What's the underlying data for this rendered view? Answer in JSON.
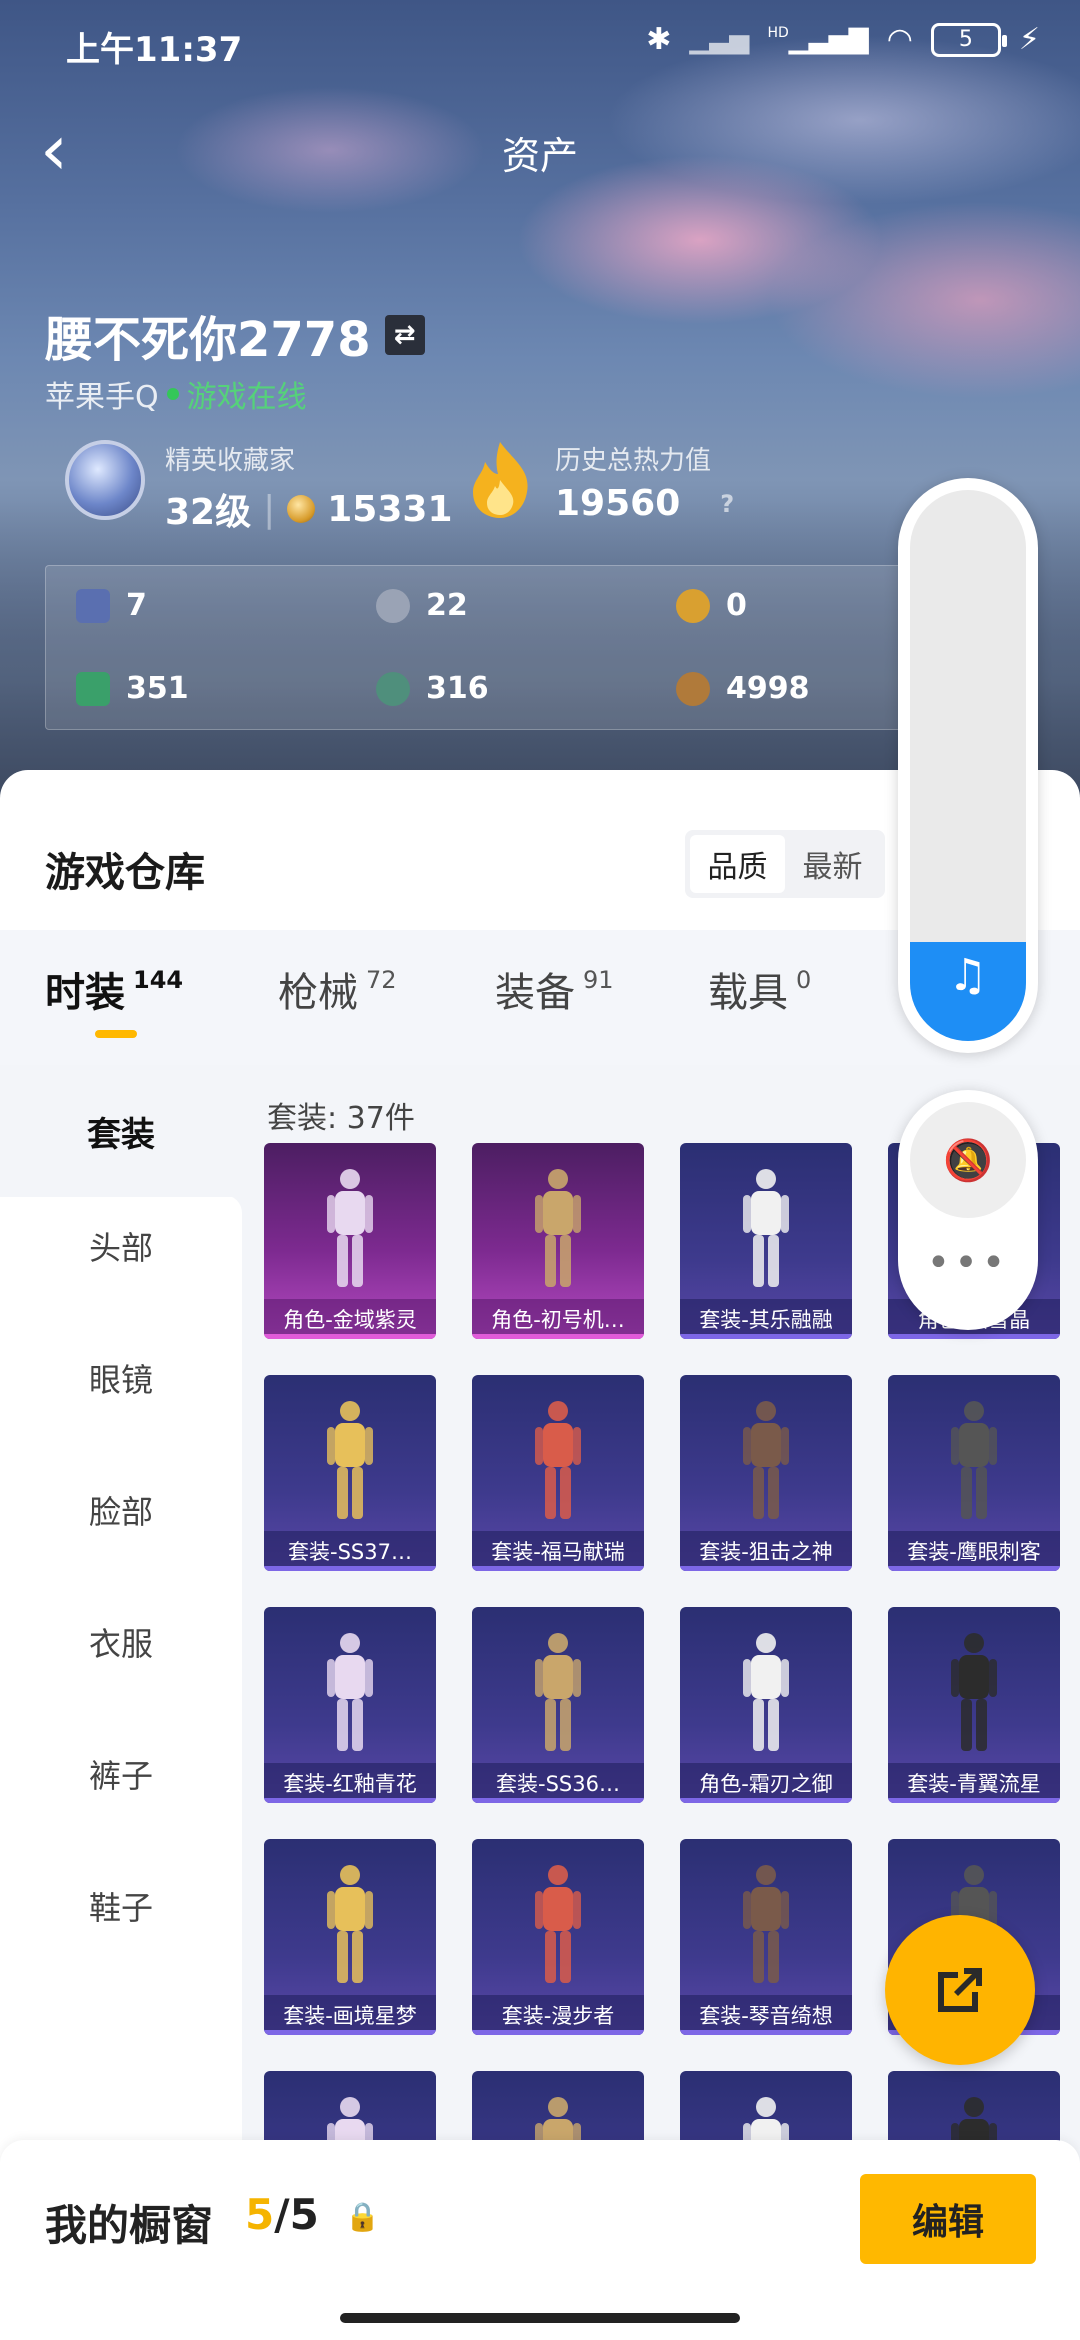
{
  "status_bar": {
    "time": "上午11:37",
    "battery": "5",
    "network": "HD"
  },
  "header": {
    "title": "资产",
    "back_icon": "back-chevron-icon"
  },
  "profile": {
    "username": "腰不死你2778",
    "platform": "苹果手Q",
    "online_status": "游戏在线",
    "rank_title": "精英收藏家",
    "level": "32级",
    "points": "15331",
    "heat_label": "历史总热力值",
    "heat_value": "19560",
    "heat_help": "?"
  },
  "currencies": [
    {
      "icon": "card-icon",
      "value": "7",
      "color": "#5a6fb0"
    },
    {
      "icon": "silver-coin-icon",
      "value": "22",
      "color": "#9aa3b5"
    },
    {
      "icon": "gold-coin-icon",
      "value": "0",
      "color": "#d9a030"
    },
    {
      "icon": "green-card-icon",
      "value": "351",
      "color": "#3aa06a"
    },
    {
      "icon": "teal-coin-icon",
      "value": "316",
      "color": "#4f8f7c"
    },
    {
      "icon": "bronze-coin-icon",
      "value": "4998",
      "color": "#b07a3a"
    }
  ],
  "warehouse": {
    "title": "游戏仓库",
    "sort_options": [
      "品质",
      "最新"
    ],
    "tabs": [
      {
        "label": "时装",
        "count": "144"
      },
      {
        "label": "枪械",
        "count": "72"
      },
      {
        "label": "装备",
        "count": "91"
      },
      {
        "label": "载具",
        "count": "0"
      }
    ],
    "categories": [
      "套装",
      "头部",
      "眼镜",
      "脸部",
      "衣服",
      "裤子",
      "鞋子"
    ],
    "count_label": "套装: 37件",
    "items": [
      {
        "label": "角色-金域紫灵",
        "style": "purple"
      },
      {
        "label": "角色-初号机…",
        "style": "purple"
      },
      {
        "label": "套装-其乐融融",
        "style": "blue"
      },
      {
        "label": "角色-霜雪晶",
        "style": "blue"
      },
      {
        "label": "套装-SS37…",
        "style": "blue"
      },
      {
        "label": "套装-福马献瑞",
        "style": "blue"
      },
      {
        "label": "套装-狙击之神",
        "style": "blue"
      },
      {
        "label": "套装-鹰眼刺客",
        "style": "blue"
      },
      {
        "label": "套装-红釉青花",
        "style": "blue"
      },
      {
        "label": "套装-SS36…",
        "style": "blue"
      },
      {
        "label": "角色-霜刃之御",
        "style": "blue"
      },
      {
        "label": "套装-青翼流星",
        "style": "blue"
      },
      {
        "label": "套装-画境星梦",
        "style": "blue"
      },
      {
        "label": "套装-漫步者",
        "style": "blue"
      },
      {
        "label": "套装-琴音绮想",
        "style": "blue"
      },
      {
        "label": "套装-暴",
        "style": "blue"
      },
      {
        "label": "",
        "style": "blue"
      },
      {
        "label": "",
        "style": "blue"
      },
      {
        "label": "",
        "style": "blue"
      },
      {
        "label": "",
        "style": "blue"
      }
    ]
  },
  "volume_overlay": {
    "level": 0.18,
    "accent": "#1e8ef5"
  },
  "showcase": {
    "title": "我的橱窗",
    "used": "5",
    "total": "5",
    "edit_label": "编辑",
    "accent": "#ffb800"
  }
}
